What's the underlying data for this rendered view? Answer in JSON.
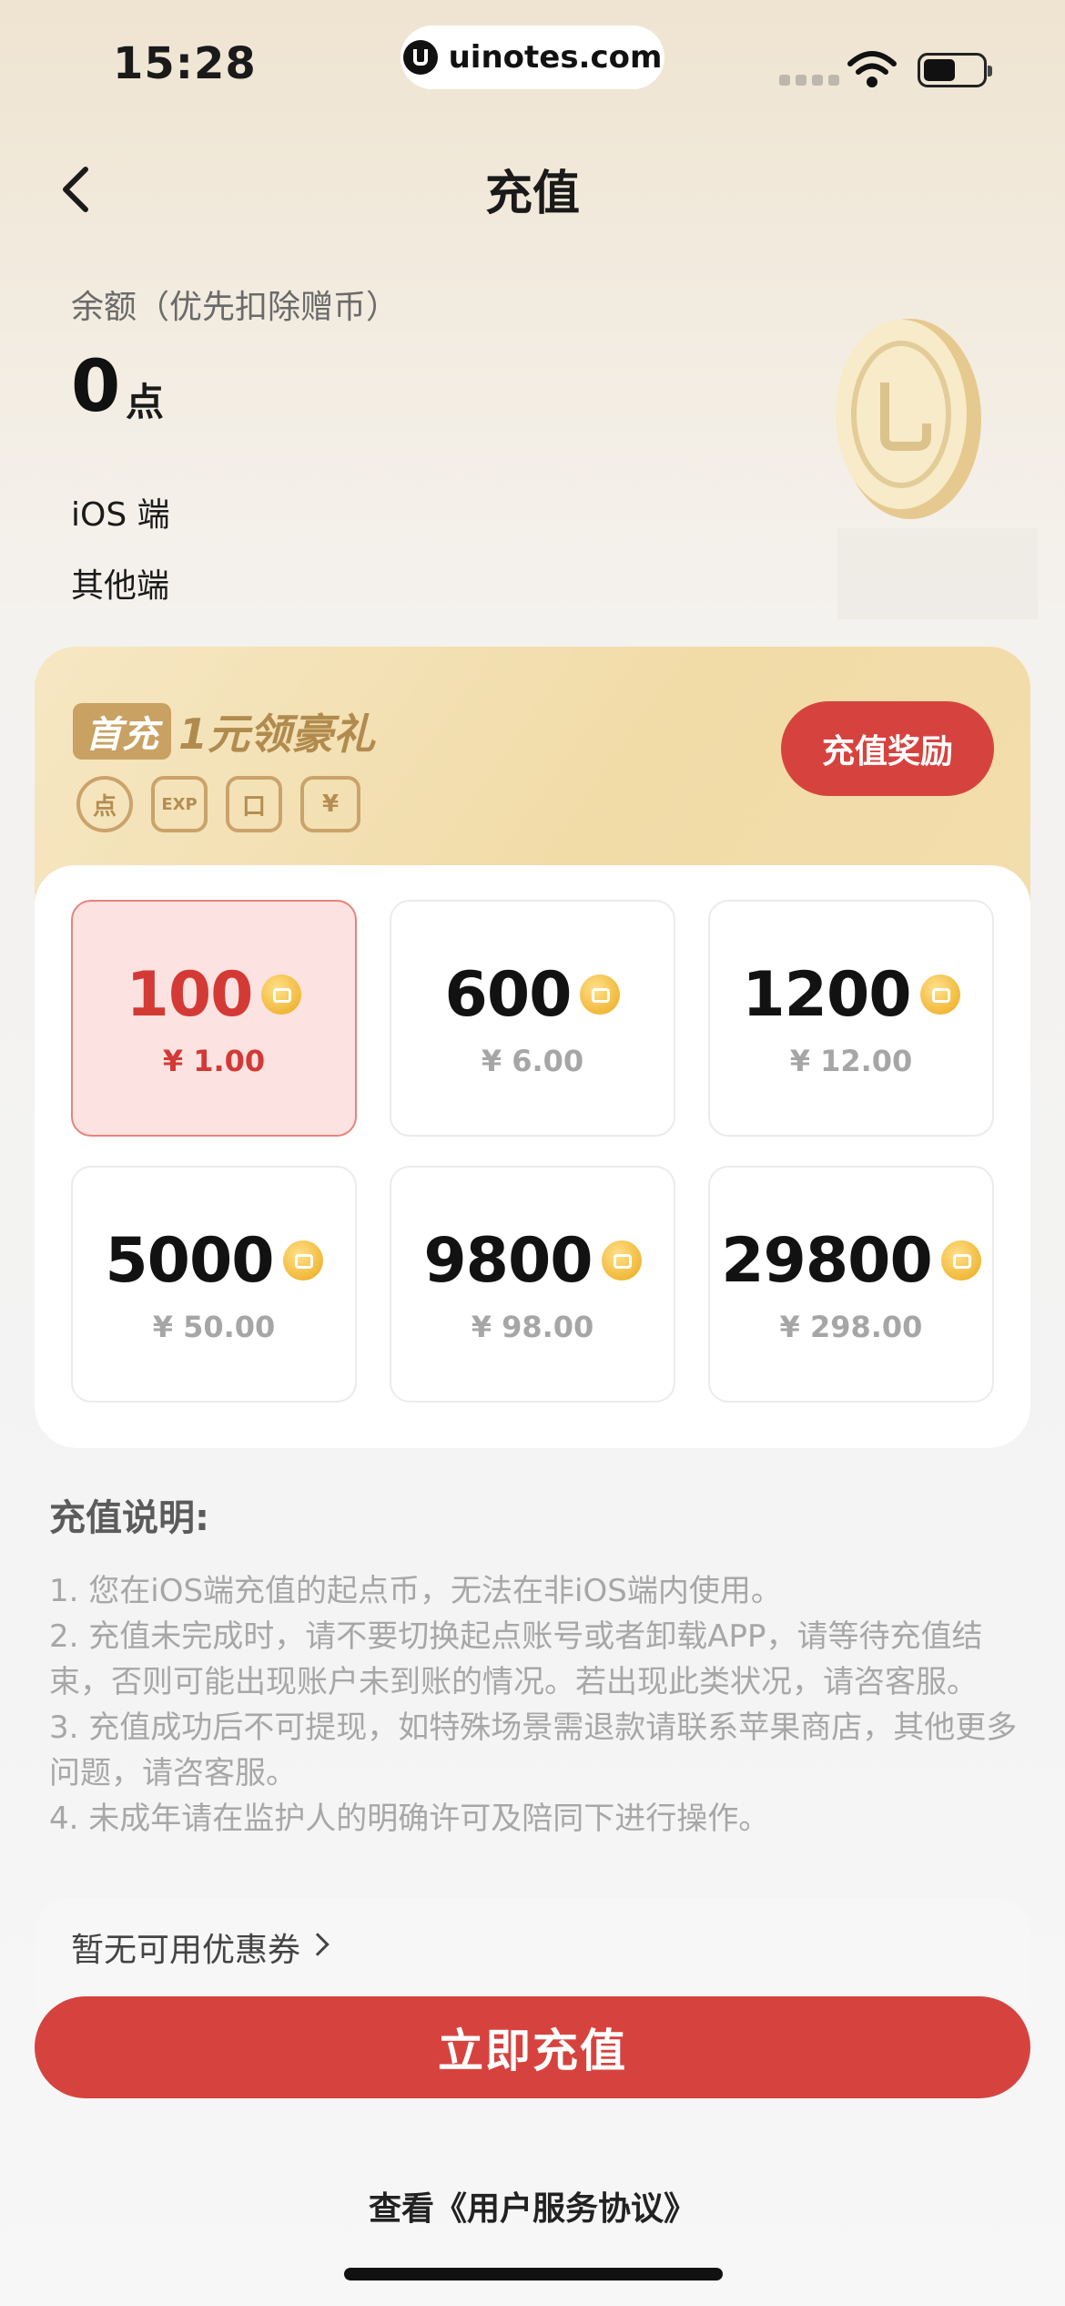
{
  "status_bar": {
    "time": "15:28",
    "url": "uinotes.com"
  },
  "header": {
    "title": "充值"
  },
  "balance": {
    "label": "余额（优先扣除赠币）",
    "value": "0",
    "unit": "点",
    "platforms": [
      "iOS 端",
      "其他端"
    ]
  },
  "promo": {
    "first_tag": "首充",
    "text": "1元领豪礼",
    "perks": [
      "点",
      "EXP",
      "口",
      "¥"
    ],
    "reward_button": "充值奖励"
  },
  "packages": [
    {
      "amount": "100",
      "price": "¥ 1.00",
      "selected": true
    },
    {
      "amount": "600",
      "price": "¥ 6.00",
      "selected": false
    },
    {
      "amount": "1200",
      "price": "¥ 12.00",
      "selected": false
    },
    {
      "amount": "5000",
      "price": "¥ 50.00",
      "selected": false
    },
    {
      "amount": "9800",
      "price": "¥ 98.00",
      "selected": false
    },
    {
      "amount": "29800",
      "price": "¥ 298.00",
      "selected": false
    }
  ],
  "instructions": {
    "heading": "充值说明:",
    "lines": [
      "1. 您在iOS端充值的起点币，无法在非iOS端内使用。",
      "2. 充值未完成时，请不要切换起点账号或者卸载APP，请等待充值结束，否则可能出现账户未到账的情况。若出现此类状况，请咨客服。",
      "3. 充值成功后不可提现，如特殊场景需退款请联系苹果商店，其他更多问题，请咨客服。",
      "4. 未成年请在监护人的明确许可及陪同下进行操作。"
    ]
  },
  "coupon": {
    "label": "暂无可用优惠券"
  },
  "pay_button": "立即充值",
  "agreement": "查看《用户服务协议》",
  "colors": {
    "accent": "#d6433f",
    "gold": "#c8a163"
  }
}
